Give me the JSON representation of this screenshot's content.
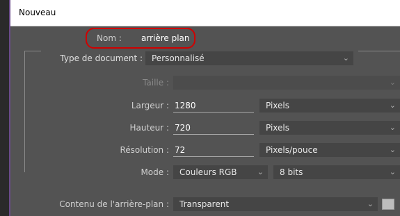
{
  "window": {
    "title": "Nouveau"
  },
  "name": {
    "label": "Nom :",
    "value": "arrière plan"
  },
  "document_type": {
    "label": "Type de document :",
    "value": "Personnalisé"
  },
  "size": {
    "label": "Taille :",
    "value": ""
  },
  "width": {
    "label": "Largeur :",
    "value": "1280",
    "unit": "Pixels"
  },
  "height": {
    "label": "Hauteur :",
    "value": "720",
    "unit": "Pixels"
  },
  "resolution": {
    "label": "Résolution :",
    "value": "72",
    "unit": "Pixels/pouce"
  },
  "mode": {
    "label": "Mode :",
    "color_mode": "Couleurs RGB",
    "bit_depth": "8 bits"
  },
  "background": {
    "label": "Contenu de l'arrière-plan :",
    "value": "Transparent"
  },
  "icons": {
    "dropdown": "chevron-down-icon"
  },
  "colors": {
    "highlight": "#d00000",
    "dialog_bg": "#535353",
    "field_bg": "#454545"
  }
}
